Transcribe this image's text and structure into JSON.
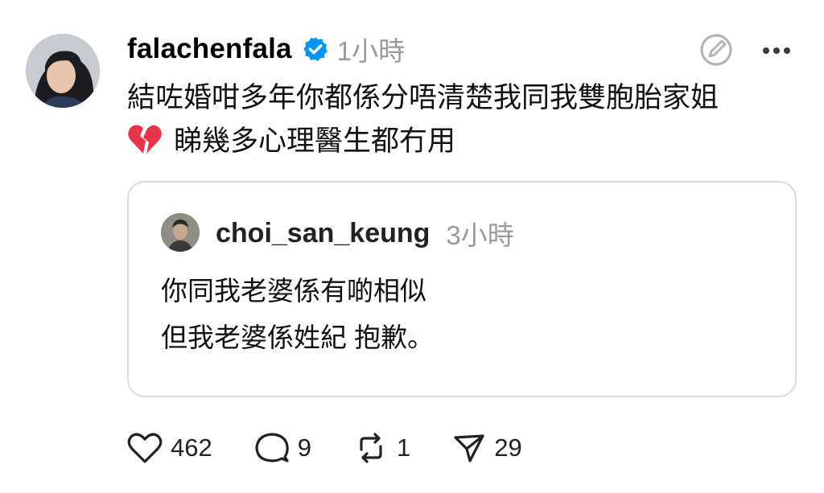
{
  "post": {
    "username": "falachenfala",
    "time": "1小時",
    "text_line1": "結咗婚咁多年你都係分唔清楚我同我雙胞胎家姐",
    "text_line2": "睇幾多心理醫生都冇用"
  },
  "quote": {
    "username": "choi_san_keung",
    "time": "3小時",
    "text_line1": "你同我老婆係有啲相似",
    "text_line2": "但我老婆係姓紀 抱歉。"
  },
  "stats": {
    "likes": "462",
    "replies": "9",
    "reposts": "1",
    "shares": "29"
  },
  "colors": {
    "verified": "#0095F6",
    "secondary_text": "#9A9A9A",
    "card_border": "#DCDCDC",
    "broken_heart": "#E8344A"
  },
  "icons": [
    "verified-badge-icon",
    "edit-pen-icon",
    "more-options-icon",
    "broken-heart-emoji",
    "heart-icon",
    "comment-icon",
    "repost-icon",
    "share-icon"
  ]
}
